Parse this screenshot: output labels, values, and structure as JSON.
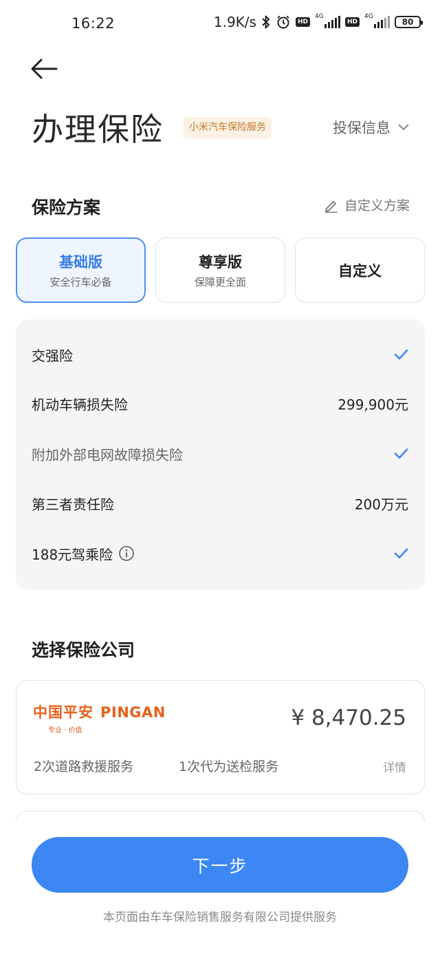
{
  "status_bar": {
    "time": "16:22",
    "speed": "1.9K/s",
    "network_1": "4G",
    "network_2": "4G",
    "hd_1": "HD",
    "hd_2": "HD",
    "battery": "80"
  },
  "header": {
    "title": "办理保险",
    "service_tag": "小米汽车保险服务",
    "info_dropdown_label": "投保信息"
  },
  "plan_section": {
    "title": "保险方案",
    "custom_link": "自定义方案",
    "plans": [
      {
        "name": "基础版",
        "subtitle": "安全行车必备",
        "selected": true
      },
      {
        "name": "尊享版",
        "subtitle": "保障更全面",
        "selected": false
      },
      {
        "name": "自定义",
        "subtitle": "",
        "selected": false
      }
    ]
  },
  "coverage": {
    "items": [
      {
        "name": "交强险",
        "value": "",
        "checked": true
      },
      {
        "name": "机动车辆损失险",
        "value": "299,900元",
        "checked": false
      },
      {
        "name": "附加外部电网故障损失险",
        "value": "",
        "checked": true
      },
      {
        "name": "第三者责任险",
        "value": "200万元",
        "checked": false
      },
      {
        "name": "188元驾乘险",
        "value": "",
        "checked": true,
        "has_info": true
      }
    ]
  },
  "company_section": {
    "title": "选择保险公司",
    "insurer": {
      "logo_cn": "中国平安",
      "logo_en": "PINGAN",
      "logo_slogan": "专业 · 价值",
      "price": "¥ 8,470.25",
      "services": [
        "2次道路救援服务",
        "1次代为送检服务"
      ],
      "details": "详情"
    }
  },
  "footer": {
    "next_button": "下一步",
    "note": "本页面由车车保险销售服务有限公司提供服务"
  },
  "colors": {
    "accent": "#3d87f5",
    "selected_bg": "#eef5ff",
    "tag_bg": "#fbf1e4",
    "tag_text": "#c07a2c",
    "pingan_orange": "#e6611d"
  }
}
